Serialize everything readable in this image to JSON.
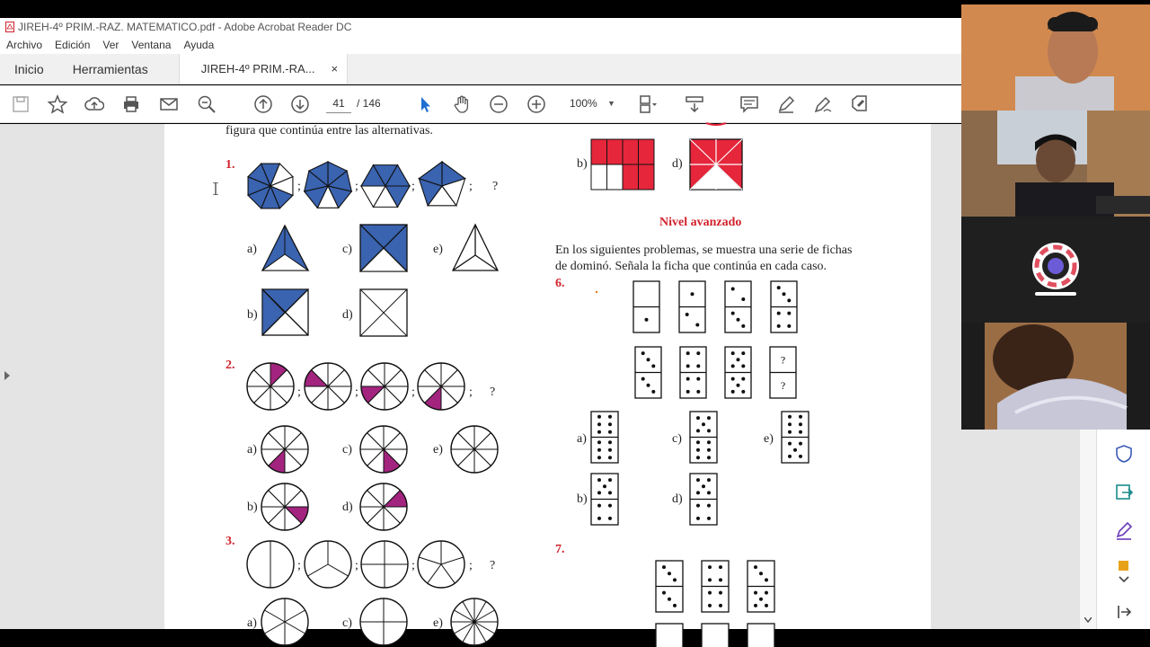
{
  "window": {
    "title": "JIREH-4º PRIM.-RAZ. MATEMATICO.pdf - Adobe Acrobat Reader DC"
  },
  "menu": [
    "Archivo",
    "Edición",
    "Ver",
    "Ventana",
    "Ayuda"
  ],
  "tabs": {
    "home": "Inicio",
    "tools": "Herramientas",
    "doc": "JIREH-4º PRIM.-RA...",
    "close": "×"
  },
  "toolbar": {
    "page_current": "41",
    "page_total": "/  146",
    "zoom": "100%"
  },
  "pdf": {
    "intro": "figura que continúa entre las alternativas.",
    "q1": "1.",
    "q2": "2.",
    "q3": "3.",
    "q6": "6.",
    "q7": "7.",
    "sep": ";",
    "unknown": "?",
    "opt_a": "a)",
    "opt_b": "b)",
    "opt_c": "c)",
    "opt_d": "d)",
    "opt_e": "e)",
    "level": "Nivel avanzado",
    "domino_intro_1": "En los siguientes problemas, se muestra una serie de fichas",
    "domino_intro_2": "de dominó. Señala la ficha que continúa en cada caso."
  },
  "colors": {
    "blue": "#3a63b0",
    "magenta": "#a3247f",
    "red": "#e5263b",
    "number": "#d0232d"
  }
}
